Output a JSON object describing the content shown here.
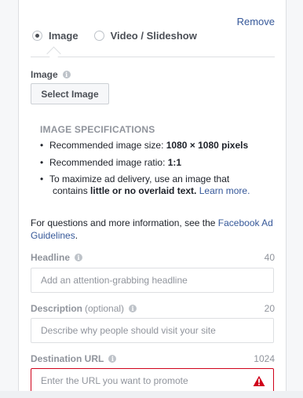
{
  "remove_label": "Remove",
  "media_type": {
    "options": [
      {
        "label": "Image",
        "selected": true
      },
      {
        "label": "Video / Slideshow",
        "selected": false
      }
    ]
  },
  "image": {
    "label": "Image",
    "select_button": "Select Image"
  },
  "specs": {
    "title": "IMAGE SPECIFICATIONS",
    "size_prefix": "Recommended image size: ",
    "size_value": "1080 × 1080 pixels",
    "ratio_prefix": "Recommended image ratio: ",
    "ratio_value": "1:1",
    "delivery_line1": "To maximize ad delivery, use an image that",
    "delivery_prefix": "contains ",
    "delivery_bold": "little or no overlaid text.",
    "learn_more": "Learn more."
  },
  "help": {
    "prefix": "For questions and more information, see the ",
    "link": "Facebook Ad Guidelines",
    "suffix": "."
  },
  "headline": {
    "label": "Headline",
    "counter": "40",
    "placeholder": "Add an attention-grabbing headline"
  },
  "description": {
    "label": "Description",
    "optional": "(optional)",
    "counter": "20",
    "placeholder": "Describe why people should visit your site"
  },
  "destination_url": {
    "label": "Destination URL",
    "counter": "1024",
    "placeholder": "Enter the URL you want to promote"
  },
  "colors": {
    "link": "#365899",
    "error": "#d0021b",
    "muted": "#90949c"
  }
}
